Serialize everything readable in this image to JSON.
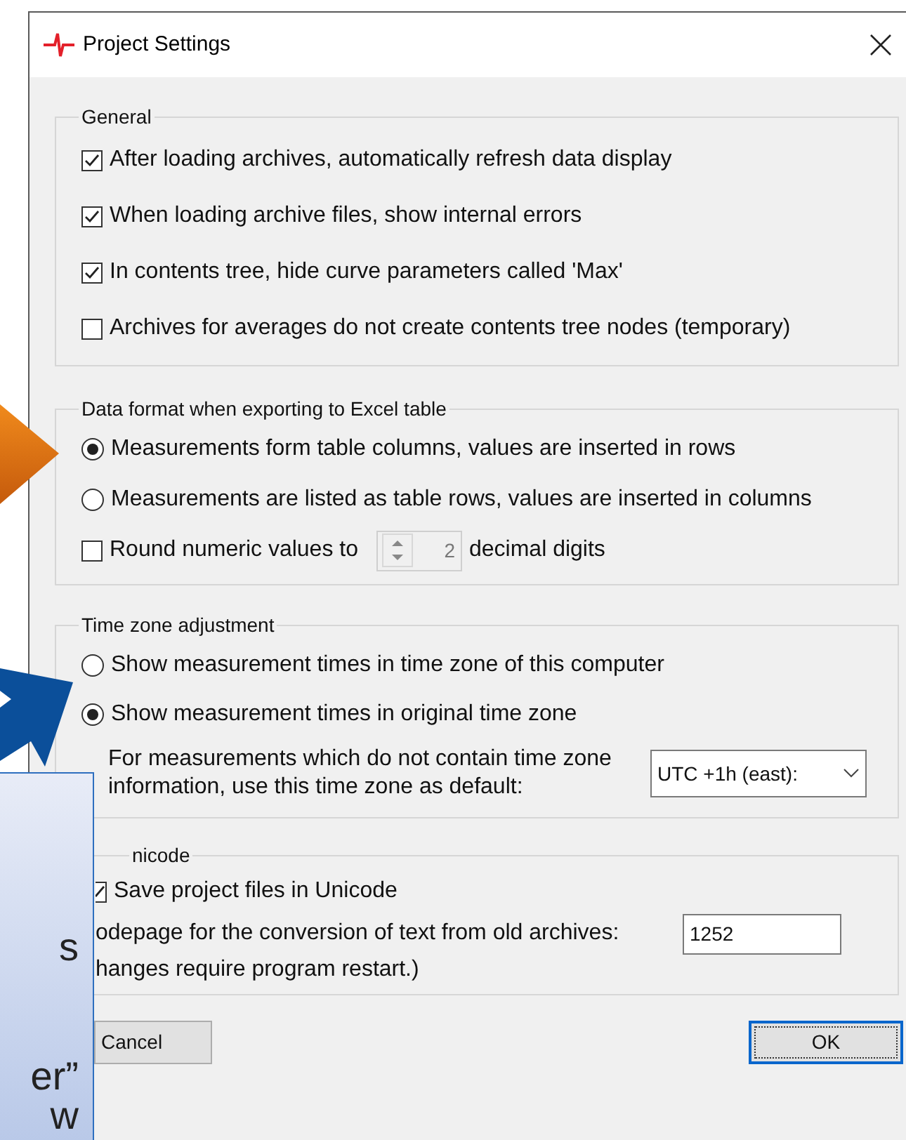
{
  "window": {
    "title": "Project Settings"
  },
  "groups": [
    {
      "title": "General",
      "items": [
        {
          "kind": "checkbox",
          "label": "After loading archives, automatically refresh data display",
          "checked": true
        },
        {
          "kind": "checkbox",
          "label": "When loading archive files, show internal errors",
          "checked": true
        },
        {
          "kind": "checkbox",
          "label": "In contents tree, hide curve parameters called 'Max'",
          "checked": true
        },
        {
          "kind": "checkbox",
          "label": "Archives for averages do not create contents tree nodes (temporary)",
          "checked": false
        }
      ]
    },
    {
      "title": "Data format when exporting to Excel table",
      "items": [
        {
          "kind": "radio",
          "label": "Measurements form table columns, values are inserted in rows",
          "selected": true
        },
        {
          "kind": "radio",
          "label": "Measurements are listed as table rows, values are inserted in columns",
          "selected": false
        },
        {
          "kind": "spinner",
          "label": "Round numeric values to",
          "checked": false,
          "value": "2",
          "suffix": "decimal digits"
        }
      ]
    },
    {
      "title": "Time zone adjustment",
      "items": [
        {
          "kind": "radio",
          "label": "Show measurement times in time zone of this computer",
          "selected": false
        },
        {
          "kind": "radio",
          "label": "Show measurement times in original time zone",
          "selected": true
        },
        {
          "kind": "select",
          "label": "For measurements which do not contain time zone information, use this time zone as default:",
          "value": "UTC +1h (east):"
        }
      ]
    },
    {
      "title": "nicode",
      "items": [
        {
          "kind": "checkbox",
          "label": "Save project files in Unicode",
          "checked": true
        },
        {
          "kind": "input",
          "label": "odepage for the conversion of text from old archives:",
          "value": "1252"
        },
        {
          "kind": "note",
          "label": "hanges require program restart.)"
        }
      ]
    }
  ],
  "buttons": [
    {
      "label": "Cancel",
      "default": false
    },
    {
      "label": "OK",
      "default": true
    }
  ],
  "callout": {
    "lines": [
      "s",
      "er”",
      "w"
    ]
  }
}
